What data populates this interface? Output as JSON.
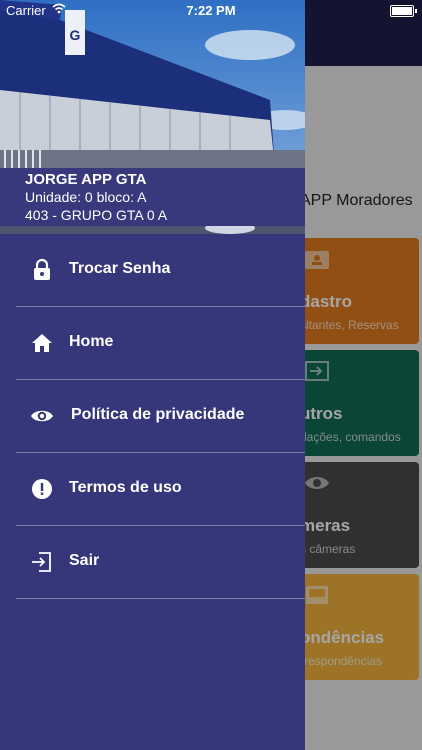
{
  "status_bar": {
    "carrier": "Carrier",
    "time": "7:22 PM"
  },
  "drawer": {
    "user": {
      "name": "JORGE APP GTA",
      "unit": "Unidade: 0 bloco: A",
      "group": "403 - GRUPO GTA 0 A"
    },
    "menu": [
      {
        "label": "Trocar Senha",
        "icon": "lock-icon"
      },
      {
        "label": "Home",
        "icon": "home-icon"
      },
      {
        "label": "Política de privacidade",
        "icon": "eye-icon"
      },
      {
        "label": "Termos de uso",
        "icon": "alert-icon"
      },
      {
        "label": "Sair",
        "icon": "exit-icon"
      }
    ]
  },
  "background": {
    "subtitle": "APP Moradores",
    "cards": [
      {
        "title": "dastro",
        "subtitle": "sitantes, Reservas",
        "color": "#e07a1f",
        "icon": "contact-card-icon"
      },
      {
        "title": "utros",
        "subtitle": "dações, comandos",
        "color": "#116a55",
        "icon": "input-icon"
      },
      {
        "title": "meras",
        "subtitle": "s câmeras",
        "color": "#4a4a4a",
        "icon": "eye-icon"
      },
      {
        "title": "ondências",
        "subtitle": "rrespondências",
        "color": "#f0b13c",
        "icon": "inbox-icon"
      }
    ]
  },
  "colors": {
    "drawer": "#36367a",
    "topbar": "#20204a"
  }
}
